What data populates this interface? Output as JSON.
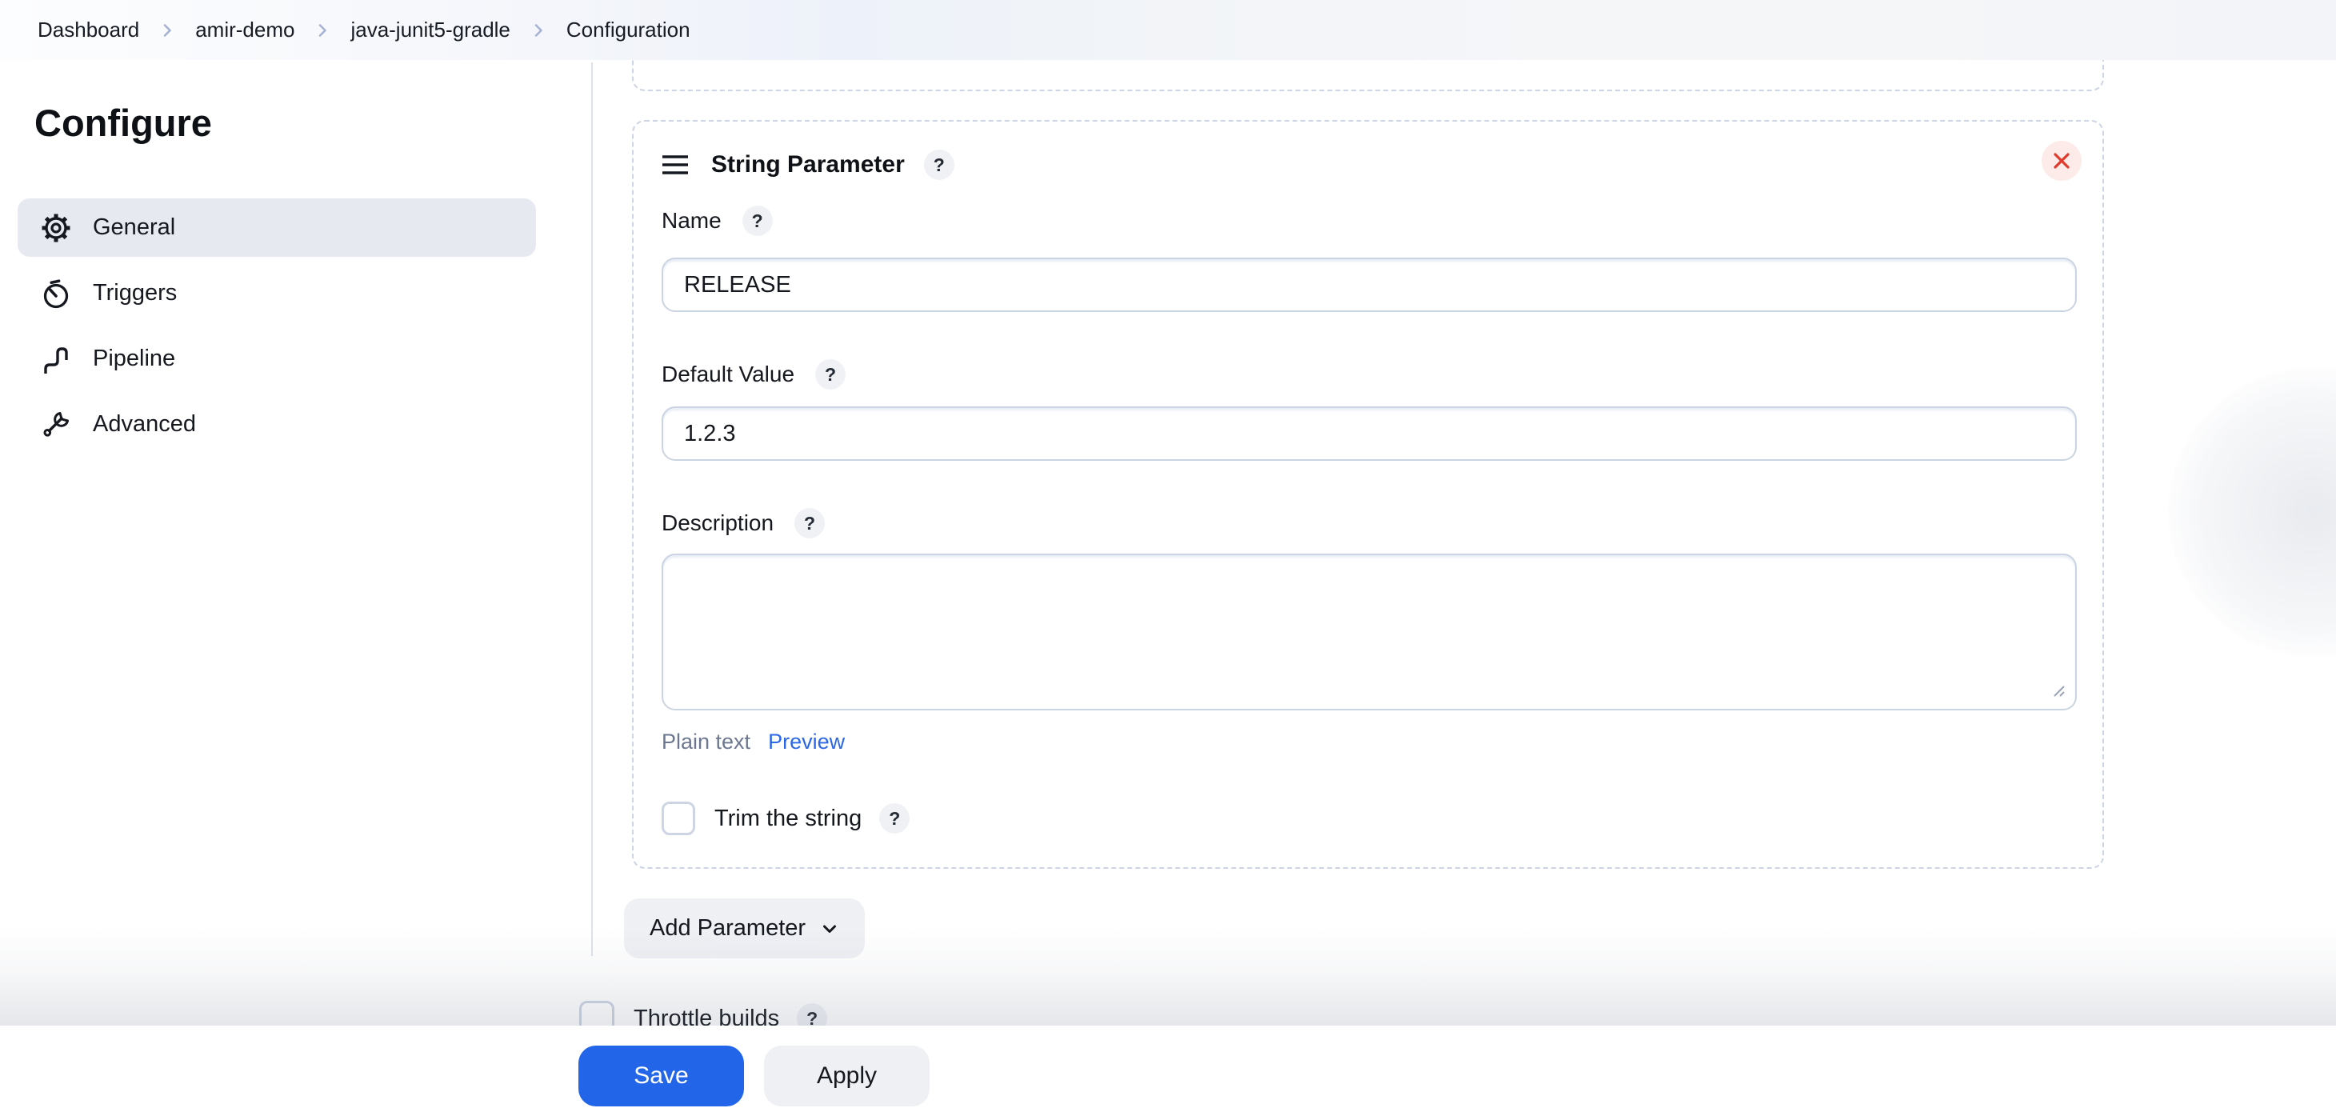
{
  "breadcrumb": {
    "items": [
      "Dashboard",
      "amir-demo",
      "java-junit5-gradle",
      "Configuration"
    ]
  },
  "sidebar": {
    "title": "Configure",
    "items": [
      {
        "label": "General",
        "icon": "gear-icon",
        "active": true
      },
      {
        "label": "Triggers",
        "icon": "timer-icon",
        "active": false
      },
      {
        "label": "Pipeline",
        "icon": "pipeline-icon",
        "active": false
      },
      {
        "label": "Advanced",
        "icon": "wrench-icon",
        "active": false
      }
    ]
  },
  "parameter_card": {
    "title": "String Parameter",
    "help_badge": "?",
    "close_icon": "x",
    "fields": {
      "name": {
        "label": "Name",
        "value": "RELEASE",
        "help_badge": "?"
      },
      "default_value": {
        "label": "Default Value",
        "value": "1.2.3",
        "help_badge": "?"
      },
      "description": {
        "label": "Description",
        "value": "",
        "help_badge": "?",
        "mode_label": "Plain text",
        "preview_label": "Preview"
      },
      "trim": {
        "label": "Trim the string",
        "checked": false,
        "help_badge": "?"
      }
    }
  },
  "add_parameter": {
    "label": "Add Parameter"
  },
  "throttle": {
    "label": "Throttle builds",
    "checked": false,
    "help_badge": "?"
  },
  "footer": {
    "save_label": "Save",
    "apply_label": "Apply"
  },
  "colors": {
    "accent_blue": "#2365e9",
    "link_blue": "#2c67e8",
    "danger_red": "#df3a2b",
    "danger_bg": "#fcebe9",
    "active_item_bg": "#e6e9f0",
    "dashed_border": "#cdd4e3",
    "input_border": "#cbd4e2"
  }
}
